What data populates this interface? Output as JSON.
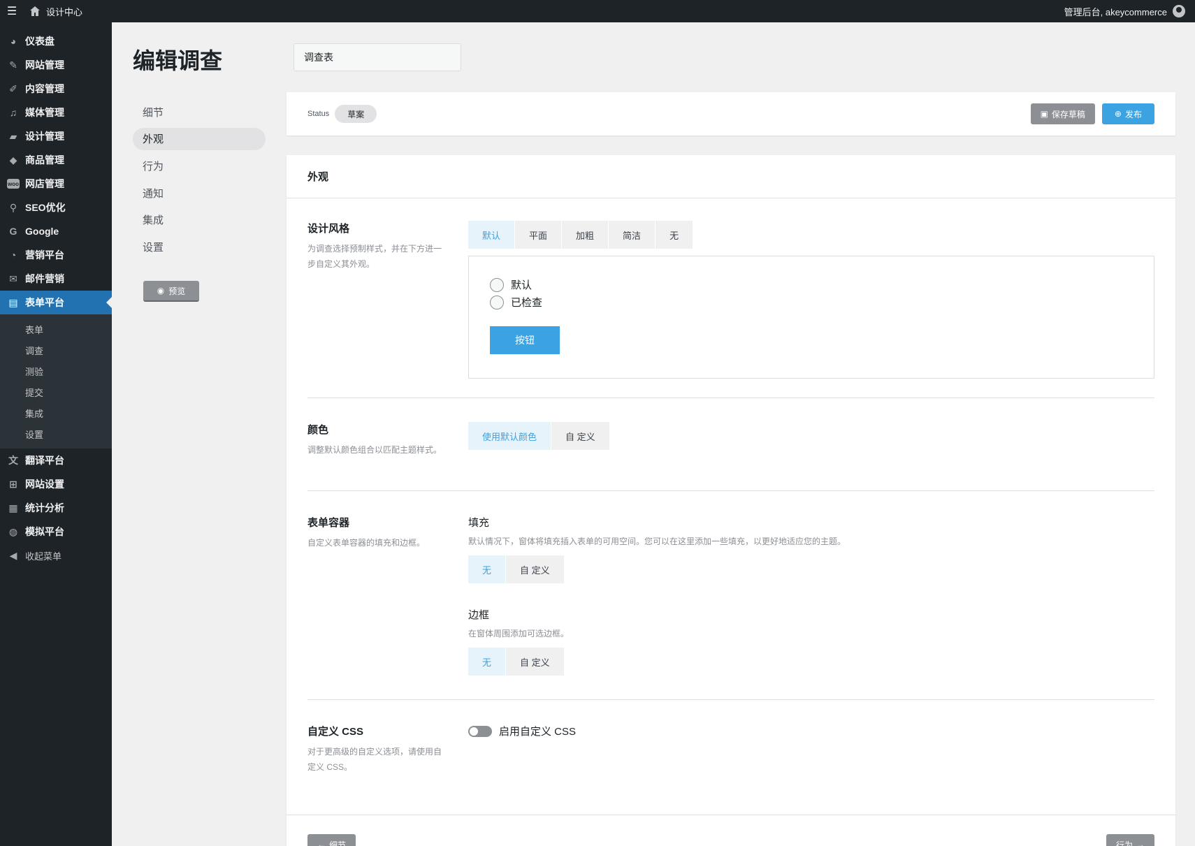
{
  "adminbar": {
    "menu_icon": "menu-icon",
    "site_name": "设计中心",
    "greeting": "管理后台, akeycommerce"
  },
  "sidebar": {
    "items": [
      {
        "label": "仪表盘",
        "icon": "dashboard-icon"
      },
      {
        "label": "网站管理",
        "icon": "pin-icon"
      },
      {
        "label": "内容管理",
        "icon": "pencil-icon"
      },
      {
        "label": "媒体管理",
        "icon": "media-icon"
      },
      {
        "label": "设计管理",
        "icon": "folder-icon"
      },
      {
        "label": "商品管理",
        "icon": "box-icon"
      },
      {
        "label": "网店管理",
        "icon": "woo-icon"
      },
      {
        "label": "SEO优化",
        "icon": "search-icon"
      },
      {
        "label": "Google",
        "icon": "google-icon"
      },
      {
        "label": "营销平台",
        "icon": "rss-icon"
      },
      {
        "label": "邮件营销",
        "icon": "mail-icon"
      },
      {
        "label": "表单平台",
        "icon": "form-icon"
      }
    ],
    "submenu": [
      "表单",
      "调查",
      "测验",
      "提交",
      "集成",
      "设置"
    ],
    "items_after": [
      {
        "label": "翻译平台",
        "icon": "translate-icon"
      },
      {
        "label": "网站设置",
        "icon": "settings-icon"
      },
      {
        "label": "统计分析",
        "icon": "analytics-icon"
      },
      {
        "label": "模拟平台",
        "icon": "globe-icon"
      }
    ],
    "collapse_label": "收起菜单"
  },
  "page": {
    "title": "编辑调查",
    "survey_name": "调查表"
  },
  "subnav": {
    "items": [
      "细节",
      "外观",
      "行为",
      "通知",
      "集成",
      "设置"
    ],
    "active": "外观",
    "preview_label": "预览"
  },
  "statusbar": {
    "status_label": "Status",
    "status_value": "草案",
    "save_draft": "保存草稿",
    "publish": "发布"
  },
  "panel": {
    "heading": "外观",
    "design_style": {
      "title": "设计风格",
      "desc": "为调查选择预制样式，并在下方进一步自定义其外观。",
      "options": [
        "默认",
        "平面",
        "加粗",
        "简洁",
        "无"
      ],
      "selected": "默认",
      "preview": {
        "radio_1": "默认",
        "radio_2": "已检查",
        "button": "按钮"
      }
    },
    "colors": {
      "title": "颜色",
      "desc": "调整默认颜色组合以匹配主题样式。",
      "options": [
        "使用默认颜色",
        "自 定义"
      ],
      "selected": "使用默认颜色"
    },
    "container": {
      "title": "表单容器",
      "desc": "自定义表单容器的填充和边框。",
      "padding_title": "填充",
      "padding_desc": "默认情况下，窗体将填充插入表单的可用空间。您可以在这里添加一些填充，以更好地适应您的主题。",
      "padding_options": [
        "无",
        "自 定义"
      ],
      "border_title": "边框",
      "border_desc": "在窗体周围添加可选边框。",
      "border_options": [
        "无",
        "自 定义"
      ]
    },
    "custom_css": {
      "title": "自定义 CSS",
      "desc": "对于更高级的自定义选项，请使用自定义 CSS。",
      "toggle_label": "启用自定义 CSS",
      "enabled": false
    },
    "footer": {
      "prev": "细节",
      "next": "行为"
    }
  },
  "colors": {
    "accent": "#3ba3e1",
    "sidebar_bg": "#1d2327",
    "active_menu": "#2271b1"
  }
}
